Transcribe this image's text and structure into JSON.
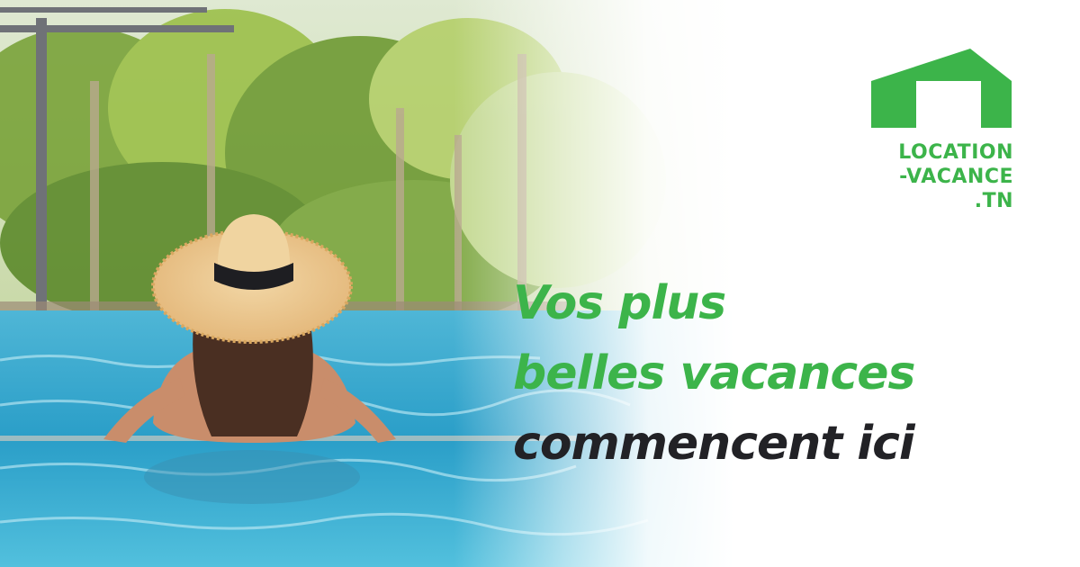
{
  "brand": {
    "logo_lines": [
      "LOCATION",
      "-VACANCE",
      ".TN"
    ],
    "color": "#3cb44a"
  },
  "headline": {
    "line1": "Vos plus",
    "line2": "belles vacances",
    "line3": "commencent ici",
    "accent_color": "#3cb44a",
    "dark_color": "#222226"
  },
  "photo": {
    "icon": "woman-in-sunhat-in-pool-photo"
  }
}
